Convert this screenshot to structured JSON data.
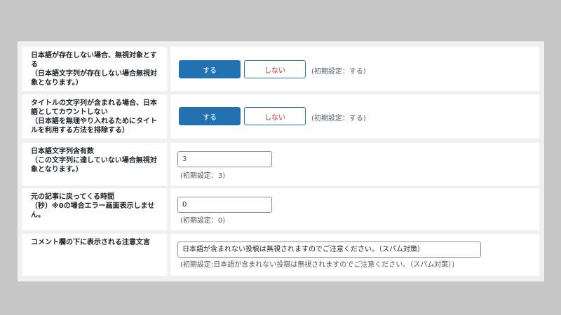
{
  "rows": [
    {
      "label": "日本語が存在しない場合、無視対象とする\n（日本語文字列が存在しない場合無視対象となります。）",
      "on_label": "する",
      "off_label": "しない",
      "default_note": "(初期設定：する)"
    },
    {
      "label": "タイトルの文字列が含まれる場合、日本語としてカウントしない\n（日本語を無理やり入れるためにタイトルを利用する方法を排除する）",
      "on_label": "する",
      "off_label": "しない",
      "default_note": "(初期設定：する)"
    },
    {
      "label": "日本語文字列含有数\n（この文字列に達していない場合無視対象となります。）",
      "input_placeholder": "3",
      "default_note": "(初期設定：3)"
    },
    {
      "label": "元の記事に戻ってくる時間\n（秒）※0の場合エラー画面表示しません。",
      "input_value": "0",
      "default_note": "(初期設定：0)"
    },
    {
      "label": "コメント欄の下に表示される注意文言",
      "input_value": "日本語が含まれない投稿は無視されますのでご注意ください。（スパム対策）",
      "default_note": "(初期設定:日本語が含まれない投稿は無視されますのでご注意ください。（スパム対策）)"
    }
  ],
  "colors": {
    "primary": "#2271b1",
    "danger": "#b32d2e",
    "panel": "#f0f0f1",
    "backdrop": "#c6c6c6"
  }
}
